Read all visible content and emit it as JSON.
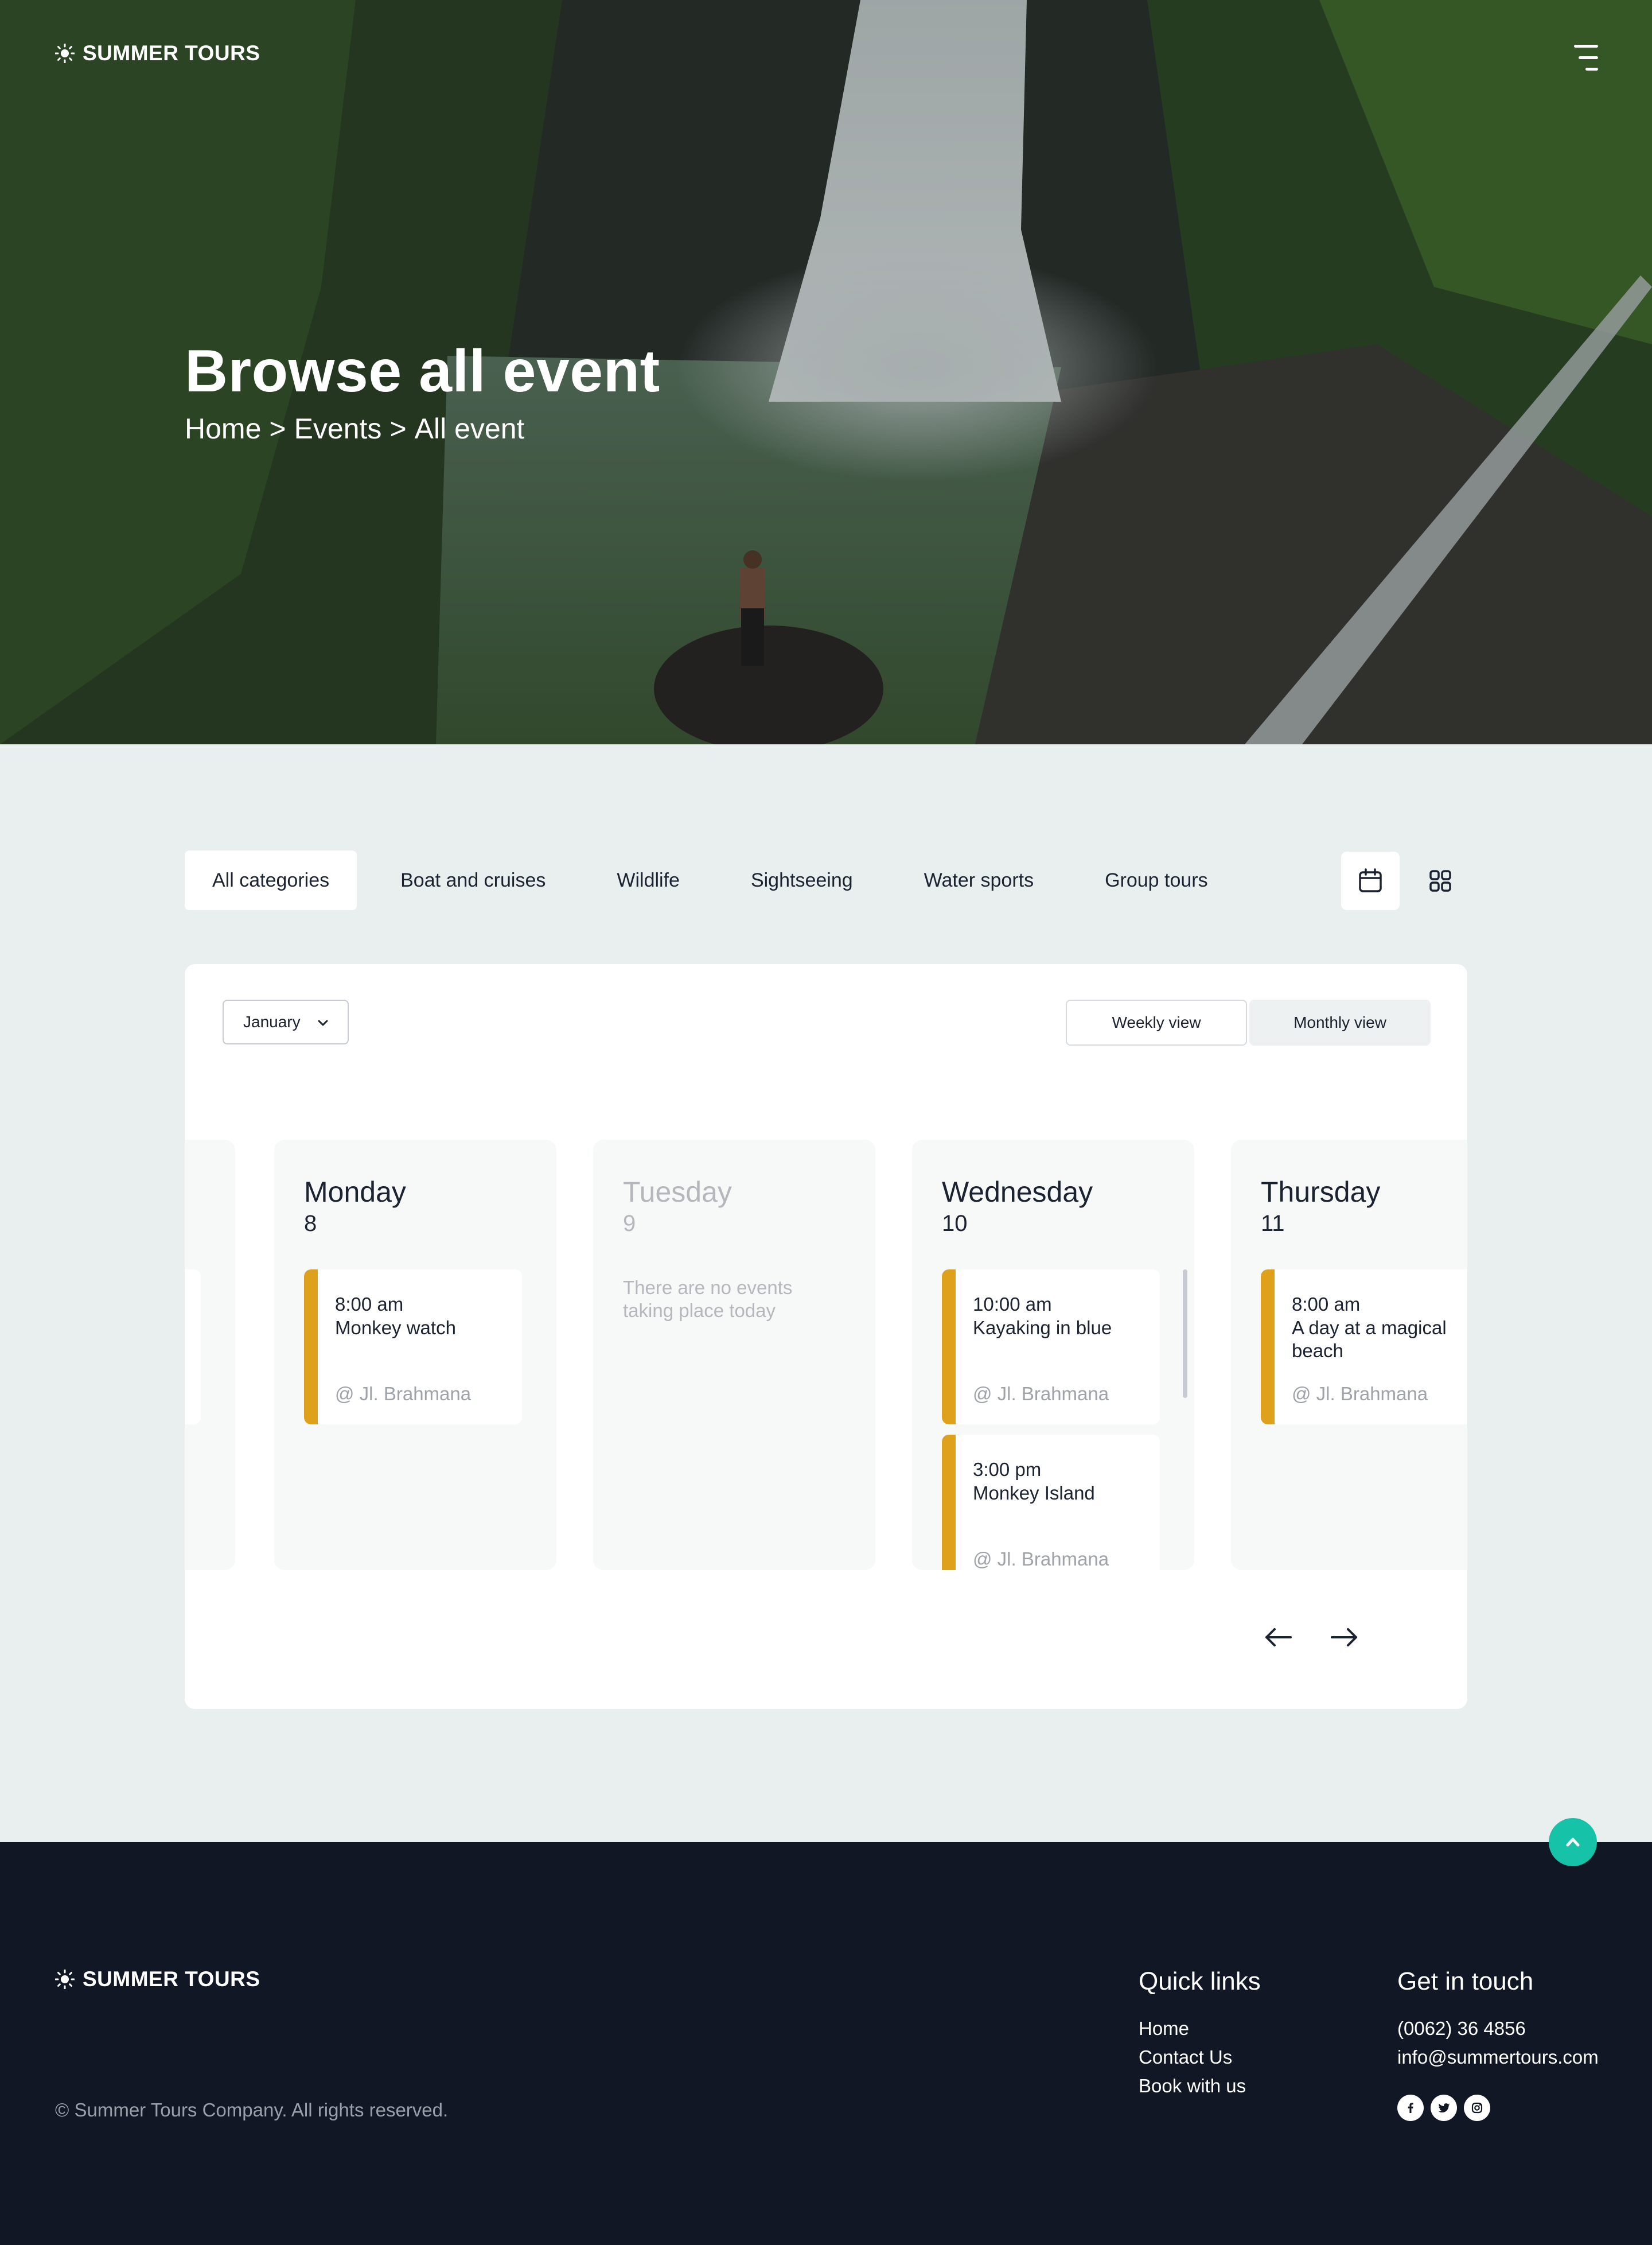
{
  "brand": {
    "name": "SUMMER TOURS"
  },
  "hero": {
    "title": "Browse all event",
    "breadcrumb": [
      "Home",
      ">",
      "Events",
      ">",
      "All event"
    ]
  },
  "categories": [
    {
      "label": "All categories",
      "active": true
    },
    {
      "label": "Boat and cruises",
      "active": false
    },
    {
      "label": "Wildlife",
      "active": false
    },
    {
      "label": "Sightseeing",
      "active": false
    },
    {
      "label": "Water sports",
      "active": false
    },
    {
      "label": "Group tours",
      "active": false
    }
  ],
  "view_icons": {
    "calendar": "calendar-icon",
    "grid": "grid-icon"
  },
  "calendar": {
    "month": "January",
    "views": {
      "weekly": "Weekly view",
      "monthly": "Monthly view"
    },
    "days": [
      {
        "name": "Monday",
        "number": "8",
        "events": [
          {
            "time": "8:00 am",
            "title": "Monkey watch",
            "location": "@ Jl. Brahmana"
          }
        ]
      },
      {
        "name": "Tuesday",
        "number": "9",
        "empty_text": "There are no events taking place today",
        "events": []
      },
      {
        "name": "Wednesday",
        "number": "10",
        "events": [
          {
            "time": "10:00 am",
            "title": "Kayaking in blue",
            "location": "@ Jl. Brahmana"
          },
          {
            "time": "3:00 pm",
            "title": "Monkey Island",
            "location": "@ Jl. Brahmana"
          }
        ]
      },
      {
        "name": "Thursday",
        "number": "11",
        "events": [
          {
            "time": "8:00 am",
            "title": "A day at a magical beach",
            "location": "@ Jl. Brahmana"
          }
        ]
      }
    ]
  },
  "footer": {
    "copyright": "© Summer Tours Company. All rights reserved.",
    "quick_links": {
      "title": "Quick links",
      "items": [
        "Home",
        "Contact Us",
        "Book with us"
      ]
    },
    "contact": {
      "title": "Get in touch",
      "phone": "(0062) 36 4856",
      "email": "info@summertours.com"
    },
    "socials": [
      "facebook-icon",
      "twitter-icon",
      "instagram-icon"
    ]
  },
  "colors": {
    "accent": "#16c3a9",
    "event_bar": "#dfa11c",
    "footer_bg": "#121726",
    "page_bg": "#e9efee"
  }
}
